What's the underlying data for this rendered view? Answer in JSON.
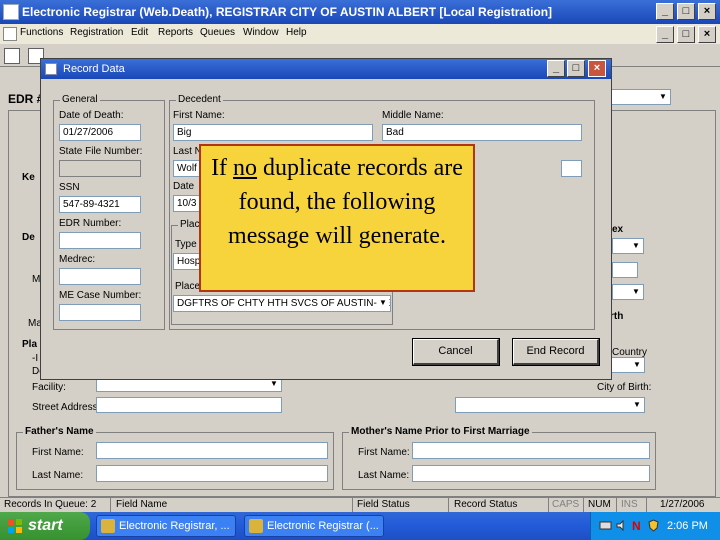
{
  "app": {
    "title": "Electronic Registrar (Web.Death), REGISTRAR   CITY OF AUSTIN   ALBERT   [Local Registration]"
  },
  "menu": {
    "items": [
      "Functions",
      "Registration",
      "Edit",
      "Reports",
      "Queues",
      "Window",
      "Help"
    ]
  },
  "background": {
    "edr_label": "EDR #",
    "labels": {
      "ex": "ex",
      "rth": "rth",
      "country": "Country",
      "city_of_birth": "City of Birth:",
      "facility": "Facility:",
      "street_address": "Street Address:",
      "ke": "Ke",
      "de": "De",
      "m": "M",
      "ma": "Ma",
      "pla": "Pla",
      "i": "-I",
      "de2": "De"
    },
    "fathers_group": {
      "title": "Father's Name",
      "first_label": "First Name:",
      "last_label": "Last Name:"
    },
    "mothers_group": {
      "title": "Mother's Name Prior to First Marriage",
      "first_label": "First Name:",
      "last_label": "Last Name:"
    }
  },
  "dialog": {
    "title": "Record Data",
    "general": {
      "title": "General",
      "date_of_death_label": "Date of Death:",
      "date_of_death_value": "01/27/2006",
      "state_file_label": "State File Number:",
      "ssn_label": "SSN",
      "ssn_value": "547-89-4321",
      "edr_number_label": "EDR Number:",
      "medrec_label": "Medrec:",
      "me_case_label": "ME Case Number:"
    },
    "decedent": {
      "title": "Decedent",
      "first_name_label": "First Name:",
      "first_name_value": "Big",
      "middle_name_label": "Middle Name:",
      "middle_name_value": "Bad",
      "last_label_partial": "Last N",
      "last_value_partial": "Wolf",
      "date_label_partial": "Date",
      "date_value_partial": "10/3",
      "place_label_partial": "Place",
      "type_label_partial": "Type",
      "type_value_partial": "Hosp",
      "place2_label_partial": "Place",
      "place_select_value": "DGFTRS OF CHTY HTH SVCS OF AUSTIN-SE"
    },
    "buttons": {
      "cancel": "Cancel",
      "end_record": "End Record"
    }
  },
  "callout": {
    "text_before": "If ",
    "text_underlined": "no",
    "text_after": " duplicate records are found, the following message will generate."
  },
  "status_bar": {
    "records_in_queue": "Records In Queue: 2",
    "field_name": "Field Name",
    "field_status": "Field Status",
    "record_status": "Record Status",
    "caps": "CAPS",
    "num": "NUM",
    "ins": "INS",
    "date": "1/27/2006"
  },
  "taskbar": {
    "start_label": "start",
    "task1": "Electronic Registrar, ...",
    "task2": "Electronic Registrar (...",
    "clock": "2:06 PM"
  }
}
